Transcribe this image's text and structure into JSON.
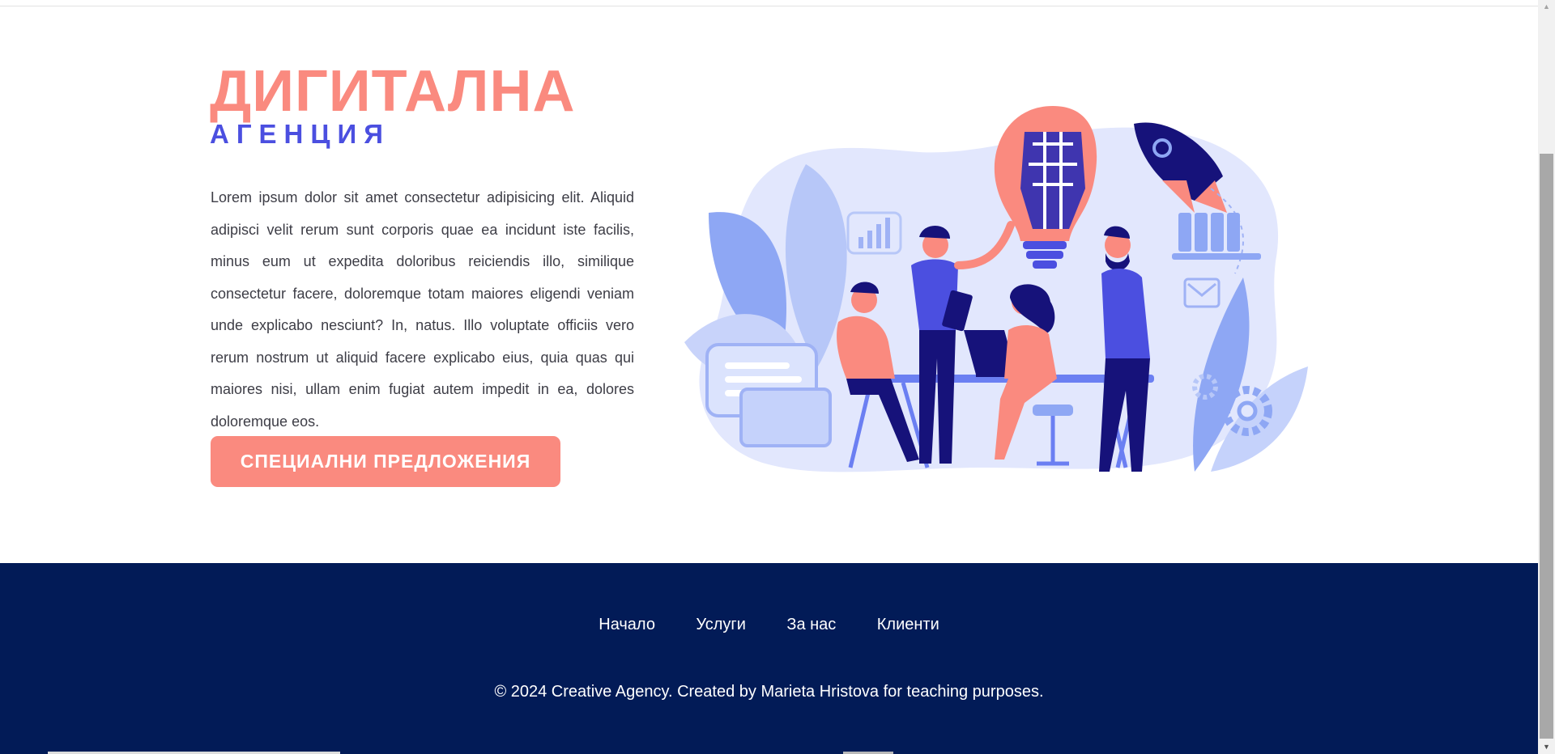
{
  "hero": {
    "title": "ДИГИТАЛНА",
    "subtitle": "АГЕНЦИЯ",
    "text": "Lorem ipsum dolor sit amet consectetur adipisicing elit. Aliquid adipisci velit rerum sunt corporis quae ea incidunt iste facilis, minus eum ut expedita doloribus reiciendis illo, similique consectetur facere, doloremque totam maiores eligendi veniam unde explicabo nesciunt? In, natus. Illo voluptate officiis vero rerum nostrum ut aliquid facere explicabo eius, quia quas qui maiores nisi, ullam enim fugiat autem impedit in ea, dolores doloremque eos.",
    "cta_label": "СПЕЦИАЛНИ ПРЕДЛОЖЕНИЯ",
    "illustration": "team-teamwork-illustration"
  },
  "footer": {
    "nav": [
      {
        "label": "Начало"
      },
      {
        "label": "Услуги"
      },
      {
        "label": "За нас"
      },
      {
        "label": "Клиенти"
      }
    ],
    "copyright": "© 2024 Creative Agency. Created by Marieta Hristova for teaching purposes."
  },
  "colors": {
    "accent_coral": "#fa8a7f",
    "accent_blue": "#4b4fe0",
    "footer_bg": "#021b57",
    "navy": "#16127a"
  },
  "scrollbar": {
    "up_icon": "arrow-up-icon",
    "down_icon": "arrow-down-icon"
  }
}
